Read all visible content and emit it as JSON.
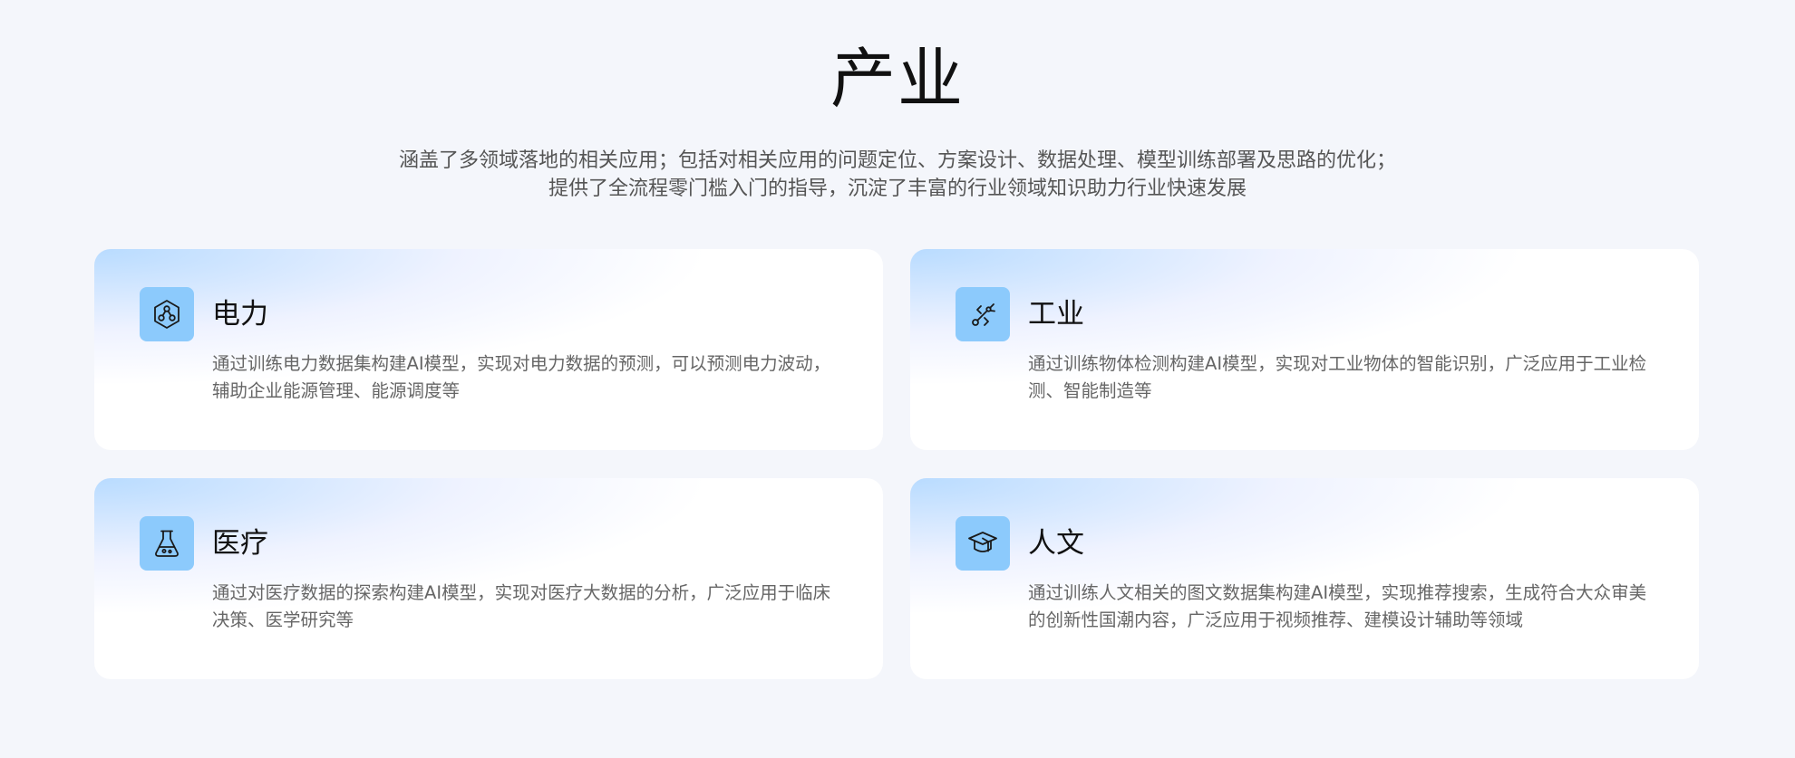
{
  "header": {
    "title": "产业",
    "subtitle_line1": "涵盖了多领域落地的相关应用；包括对相关应用的问题定位、方案设计、数据处理、模型训练部署及思路的优化；",
    "subtitle_line2": "提供了全流程零门槛入门的指导，沉淀了丰富的行业领域知识助力行业快速发展"
  },
  "colors": {
    "background": "#f4f6fb",
    "icon_bg": "#8ccafc",
    "card_gradient": "#7ebeff"
  },
  "cards": [
    {
      "icon": "hexagon-nodes-icon",
      "title": "电力",
      "description": "通过训练电力数据集构建AI模型，实现对电力数据的预测，可以预测电力波动，辅助企业能源管理、能源调度等"
    },
    {
      "icon": "robot-arm-icon",
      "title": "工业",
      "description": "通过训练物体检测构建AI模型，实现对工业物体的智能识别，广泛应用于工业检测、智能制造等"
    },
    {
      "icon": "flask-icon",
      "title": "医疗",
      "description": "通过对医疗数据的探索构建AI模型，实现对医疗大数据的分析，广泛应用于临床决策、医学研究等"
    },
    {
      "icon": "graduation-cap-icon",
      "title": "人文",
      "description": "通过训练人文相关的图文数据集构建AI模型，实现推荐搜索，生成符合大众审美的创新性国潮内容，广泛应用于视频推荐、建模设计辅助等领域"
    }
  ]
}
